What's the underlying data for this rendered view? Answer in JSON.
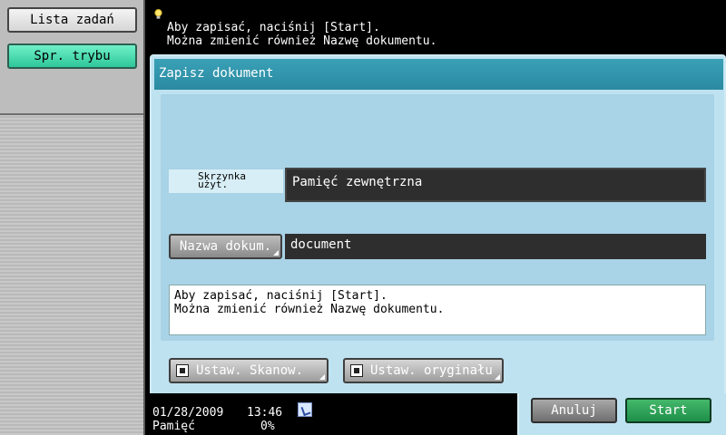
{
  "sidebar": {
    "job_list_label": "Lista zadań",
    "mode_check_label": "Spr. trybu"
  },
  "top_message": "Aby zapisać, naciśnij [Start].\nMożna zmienić również Nazwę dokumentu.",
  "dialog": {
    "title": "Zapisz dokument",
    "box_label": "Skrzynka\nużyt.",
    "box_value": "Pamięć zewnętrzna",
    "docname_button_label": "Nazwa dokum.",
    "docname_value": "document",
    "info_text": "Aby zapisać, naciśnij [Start].\nMożna zmienić również Nazwę dokumentu.",
    "scan_settings_label": "Ustaw. Skanow.",
    "original_settings_label": "Ustaw. oryginału"
  },
  "status": {
    "date": "01/28/2009",
    "time": "13:46",
    "memory_label": "Pamięć",
    "memory_value": "0%"
  },
  "actions": {
    "cancel_label": "Anuluj",
    "start_label": "Start"
  },
  "colors": {
    "title_bar": "#2a8aa1",
    "dialog_bg": "#bfe2f0",
    "start_green": "#1f8f49",
    "mode_check_green": "#2fc69b"
  }
}
